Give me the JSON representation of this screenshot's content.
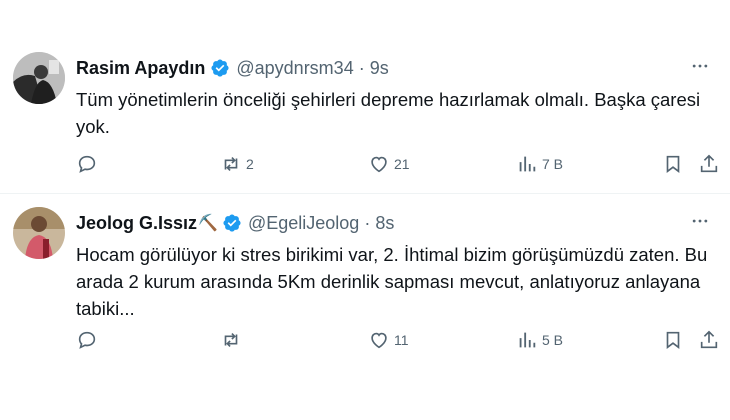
{
  "tweets": [
    {
      "name": "Rasim Apaydın",
      "name_emoji": "",
      "handle": "@apydnrsm34",
      "separator": "·",
      "time": "9s",
      "text": "Tüm yönetimlerin önceliği şehirleri depreme hazırlamak olmalı. Başka çaresi yok.",
      "replies": "",
      "retweets": "2",
      "likes": "21",
      "views": "7 B"
    },
    {
      "name": "Jeolog G.Issız",
      "name_emoji": "⛏️",
      "handle": "@EgeliJeolog",
      "separator": "·",
      "time": "8s",
      "text": "Hocam görülüyor ki stres birikimi var, 2. İhtimal bizim görüşümüzdü zaten. Bu arada 2 kurum arasında 5Km derinlik sapması mevcut, anlatıyoruz anlayana tabiki...",
      "replies": "",
      "retweets": "",
      "likes": "11",
      "views": "5 B"
    }
  ],
  "colors": {
    "verified": "#1d9bf0",
    "text": "#0f1419",
    "muted": "#536471",
    "divider": "#eff3f4"
  },
  "icons": {
    "more": "more-dots-icon",
    "reply": "reply-icon",
    "retweet": "retweet-icon",
    "like": "heart-icon",
    "views": "views-chart-icon",
    "bookmark": "bookmark-icon",
    "share": "share-icon",
    "verified": "verified-badge-icon"
  }
}
